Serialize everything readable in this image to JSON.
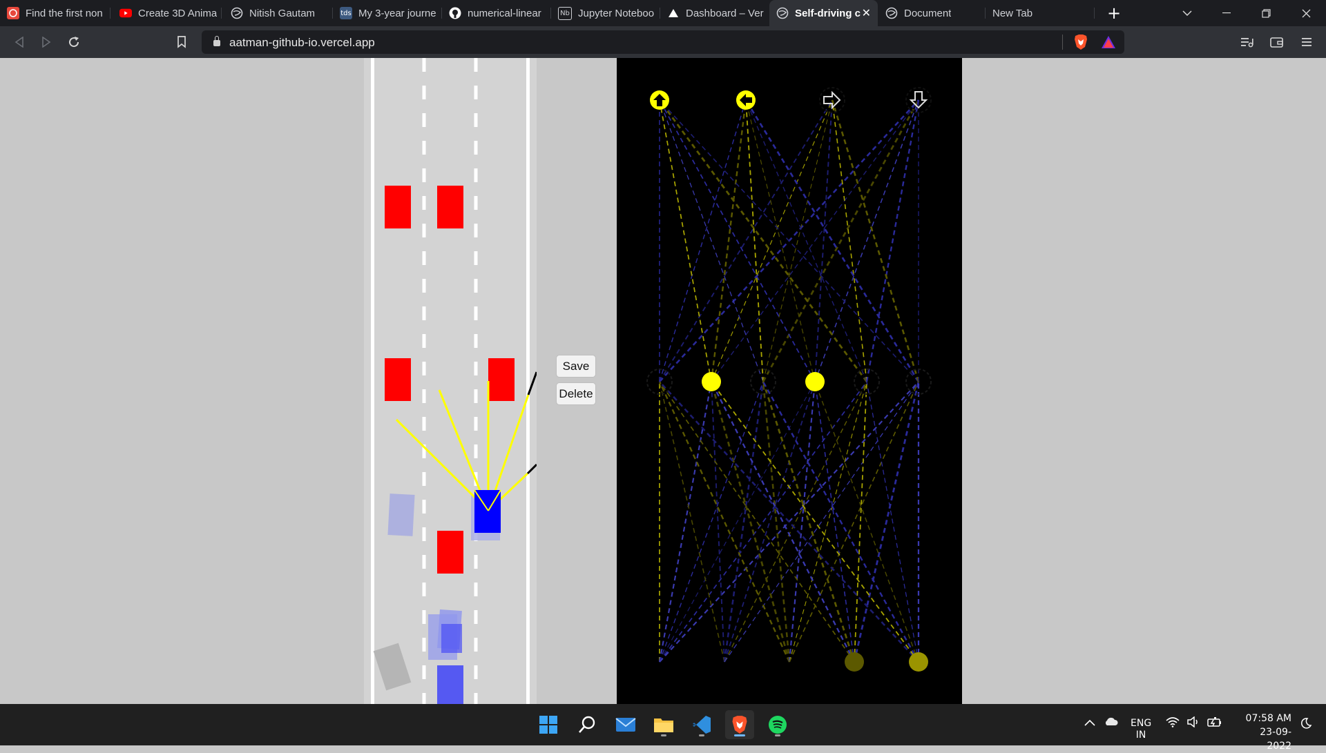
{
  "browser": {
    "tabs": [
      {
        "label": "Find the first non",
        "icon": "openai-icon",
        "color": "#e8483c"
      },
      {
        "label": "Create 3D Anima",
        "icon": "youtube-icon",
        "color": "#ff0000"
      },
      {
        "label": "Nitish Gautam",
        "icon": "globe-icon",
        "color": "#cfd1d6"
      },
      {
        "label": "My 3-year journe",
        "icon": "tds-icon",
        "color": "#3d5a80",
        "icon_text": "tds"
      },
      {
        "label": "numerical-linear",
        "icon": "github-icon",
        "color": "#ffffff"
      },
      {
        "label": "Jupyter Noteboo",
        "icon": "notebook-icon",
        "color": "#cfd1d6",
        "icon_text": "Nb"
      },
      {
        "label": "Dashboard – Ver",
        "icon": "vercel-icon",
        "color": "#ffffff"
      },
      {
        "label": "Self-driving c",
        "icon": "globe-icon",
        "color": "#cfd1d6",
        "active": true
      },
      {
        "label": "Document",
        "icon": "globe-icon",
        "color": "#cfd1d6"
      },
      {
        "label": "New Tab",
        "icon": "",
        "color": ""
      }
    ],
    "new_tab_symbol": "+",
    "tab_close_symbol": "✕",
    "url": "aatman-github-io.vercel.app"
  },
  "page": {
    "save_label": "Save",
    "delete_label": "Delete"
  },
  "taskbar": {
    "apps": [
      "windows-start-icon",
      "search-icon",
      "mail-icon",
      "file-explorer-icon",
      "vscode-icon",
      "brave-icon",
      "spotify-icon"
    ],
    "language_top": "ENG",
    "language_bottom": "IN",
    "time": "07:58 AM",
    "date": "23-09-2022"
  },
  "colors": {
    "accent_yellow": "#ffff00",
    "obstacle_red": "#ff0000",
    "car_blue": "#0000ff",
    "network_bg": "#000000",
    "road": "#d3d3d3"
  }
}
